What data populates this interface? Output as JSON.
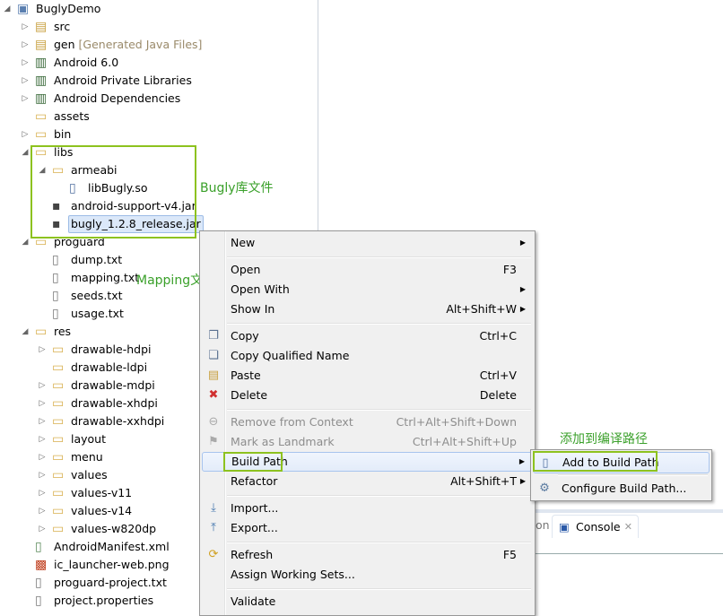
{
  "tree": [
    {
      "label": "BuglyDemo",
      "level": 0,
      "arrow": "expanded",
      "icon": "project-icon"
    },
    {
      "label": "src",
      "level": 1,
      "arrow": "collapsed",
      "icon": "source-folder-icon"
    },
    {
      "label": "gen",
      "decoration": "[Generated Java Files]",
      "level": 1,
      "arrow": "collapsed",
      "icon": "source-folder-icon"
    },
    {
      "label": "Android 6.0",
      "level": 1,
      "arrow": "collapsed",
      "icon": "library-icon"
    },
    {
      "label": "Android Private Libraries",
      "level": 1,
      "arrow": "collapsed",
      "icon": "library-icon"
    },
    {
      "label": "Android Dependencies",
      "level": 1,
      "arrow": "collapsed",
      "icon": "library-icon"
    },
    {
      "label": "assets",
      "level": 1,
      "arrow": "none",
      "icon": "folder-icon"
    },
    {
      "label": "bin",
      "level": 1,
      "arrow": "collapsed",
      "icon": "folder-icon"
    },
    {
      "label": "libs",
      "level": 1,
      "arrow": "expanded",
      "icon": "folder-icon"
    },
    {
      "label": "armeabi",
      "level": 2,
      "arrow": "expanded",
      "icon": "folder-icon"
    },
    {
      "label": "libBugly.so",
      "level": 3,
      "arrow": "none",
      "icon": "binary-file-icon"
    },
    {
      "label": "android-support-v4.jar",
      "level": 2,
      "arrow": "none",
      "icon": "jar-icon"
    },
    {
      "label": "bugly_1.2.8_release.jar",
      "level": 2,
      "arrow": "none",
      "icon": "jar-icon",
      "selected": true
    },
    {
      "label": "proguard",
      "level": 1,
      "arrow": "expanded",
      "icon": "folder-icon"
    },
    {
      "label": "dump.txt",
      "level": 2,
      "arrow": "none",
      "icon": "text-file-icon"
    },
    {
      "label": "mapping.txt",
      "level": 2,
      "arrow": "none",
      "icon": "text-file-icon"
    },
    {
      "label": "seeds.txt",
      "level": 2,
      "arrow": "none",
      "icon": "text-file-icon"
    },
    {
      "label": "usage.txt",
      "level": 2,
      "arrow": "none",
      "icon": "text-file-icon"
    },
    {
      "label": "res",
      "level": 1,
      "arrow": "expanded",
      "icon": "folder-icon"
    },
    {
      "label": "drawable-hdpi",
      "level": 2,
      "arrow": "collapsed",
      "icon": "folder-icon"
    },
    {
      "label": "drawable-ldpi",
      "level": 2,
      "arrow": "none",
      "icon": "folder-icon"
    },
    {
      "label": "drawable-mdpi",
      "level": 2,
      "arrow": "collapsed",
      "icon": "folder-icon"
    },
    {
      "label": "drawable-xhdpi",
      "level": 2,
      "arrow": "collapsed",
      "icon": "folder-icon"
    },
    {
      "label": "drawable-xxhdpi",
      "level": 2,
      "arrow": "collapsed",
      "icon": "folder-icon"
    },
    {
      "label": "layout",
      "level": 2,
      "arrow": "collapsed",
      "icon": "folder-icon"
    },
    {
      "label": "menu",
      "level": 2,
      "arrow": "collapsed",
      "icon": "folder-icon"
    },
    {
      "label": "values",
      "level": 2,
      "arrow": "collapsed",
      "icon": "folder-icon"
    },
    {
      "label": "values-v11",
      "level": 2,
      "arrow": "collapsed",
      "icon": "folder-icon"
    },
    {
      "label": "values-v14",
      "level": 2,
      "arrow": "collapsed",
      "icon": "folder-icon"
    },
    {
      "label": "values-w820dp",
      "level": 2,
      "arrow": "collapsed",
      "icon": "folder-icon"
    },
    {
      "label": "AndroidManifest.xml",
      "level": 1,
      "arrow": "none",
      "icon": "xml-file-icon"
    },
    {
      "label": "ic_launcher-web.png",
      "level": 1,
      "arrow": "none",
      "icon": "image-file-icon"
    },
    {
      "label": "proguard-project.txt",
      "level": 1,
      "arrow": "none",
      "icon": "text-file-icon"
    },
    {
      "label": "project.properties",
      "level": 1,
      "arrow": "none",
      "icon": "text-file-icon"
    }
  ],
  "annotations": {
    "bugly_lib": "Bugly库文件",
    "mapping": "Mapping文件",
    "add_to_path": "添加到编译路径"
  },
  "menu": [
    {
      "label": "New",
      "submenu": true
    },
    {
      "sep": true
    },
    {
      "label": "Open",
      "shortcut": "F3"
    },
    {
      "label": "Open With",
      "submenu": true
    },
    {
      "label": "Show In",
      "shortcut": "Alt+Shift+W",
      "submenu": true
    },
    {
      "sep": true
    },
    {
      "label": "Copy",
      "shortcut": "Ctrl+C",
      "icon": "copy-icon"
    },
    {
      "label": "Copy Qualified Name",
      "icon": "copy-qualified-name-icon"
    },
    {
      "label": "Paste",
      "shortcut": "Ctrl+V",
      "icon": "paste-icon"
    },
    {
      "label": "Delete",
      "shortcut": "Delete",
      "icon": "delete-icon"
    },
    {
      "sep": true
    },
    {
      "label": "Remove from Context",
      "shortcut": "Ctrl+Alt+Shift+Down",
      "disabled": true,
      "icon": "remove-context-icon"
    },
    {
      "label": "Mark as Landmark",
      "shortcut": "Ctrl+Alt+Shift+Up",
      "disabled": true,
      "icon": "landmark-icon"
    },
    {
      "label": "Build Path",
      "submenu": true,
      "highlighted": true
    },
    {
      "label": "Refactor",
      "shortcut": "Alt+Shift+T",
      "submenu": true
    },
    {
      "sep": true
    },
    {
      "label": "Import...",
      "icon": "import-icon"
    },
    {
      "label": "Export...",
      "icon": "export-icon"
    },
    {
      "sep": true
    },
    {
      "label": "Refresh",
      "shortcut": "F5",
      "icon": "refresh-icon"
    },
    {
      "label": "Assign Working Sets..."
    },
    {
      "sep": true
    },
    {
      "label": "Validate"
    }
  ],
  "submenu": [
    {
      "label": "Add to Build Path",
      "icon": "jar-binary-icon",
      "highlighted": true
    },
    {
      "label": "Configure Build Path...",
      "icon": "configure-build-path-icon"
    }
  ],
  "console_tab": {
    "partial_label": "on",
    "label": "Console"
  },
  "colors": {
    "highlight_box": "#8dc21f",
    "annotation_text": "#3aa02a",
    "selection": "#dbe8f9"
  }
}
